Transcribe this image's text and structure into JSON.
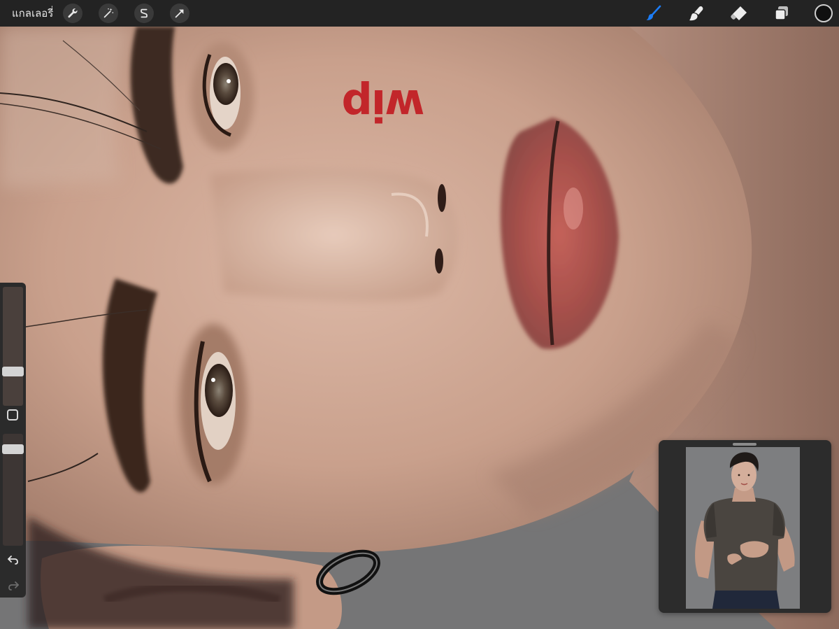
{
  "toolbar": {
    "gallery_label": "แกลเลอรี่",
    "left_tools": [
      {
        "name": "actions",
        "icon": "wrench-icon"
      },
      {
        "name": "adjustments",
        "icon": "magic-wand-icon"
      },
      {
        "name": "selection",
        "icon": "selection-s-icon"
      },
      {
        "name": "transform",
        "icon": "arrow-cursor-icon"
      }
    ],
    "right_tools": [
      {
        "name": "brush",
        "icon": "brush-icon",
        "active": true
      },
      {
        "name": "smudge",
        "icon": "smudge-icon",
        "active": false
      },
      {
        "name": "eraser",
        "icon": "eraser-icon",
        "active": false
      },
      {
        "name": "layers",
        "icon": "layers-icon",
        "active": false
      }
    ],
    "current_color": "#101010",
    "active_tool_color": "#1c7cf4"
  },
  "canvas": {
    "annotation_text": "wip",
    "annotation_color": "#c2262a"
  },
  "sidebar": {
    "brush_size_level": 0.27,
    "brush_opacity_level": 0.9
  },
  "reference": {
    "title": ""
  }
}
